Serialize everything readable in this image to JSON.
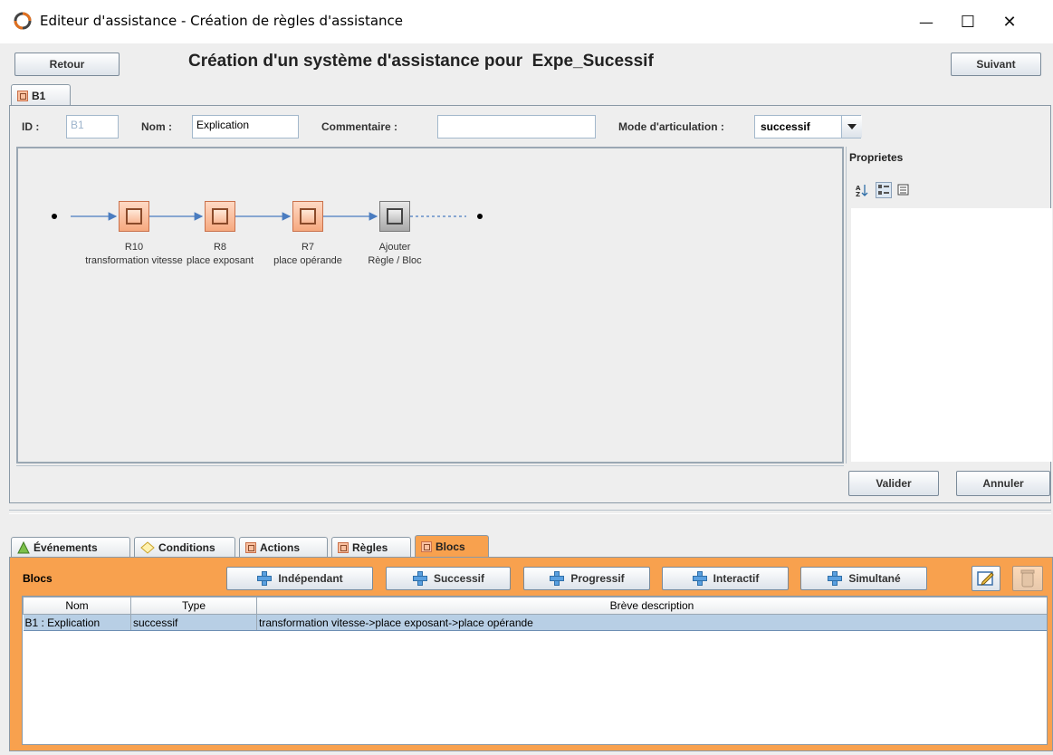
{
  "window": {
    "title": "Editeur d'assistance - Création de règles d'assistance",
    "controls": [
      "—",
      "☐",
      "✕"
    ]
  },
  "header": {
    "back_label": "Retour",
    "title": "Création d'un système d'assistance pour  Expe_Sucessif",
    "next_label": "Suivant"
  },
  "block_tab": {
    "label": "B1"
  },
  "form": {
    "id_label": "ID :",
    "id_value": "B1",
    "name_label": "Nom :",
    "name_value": "Explication",
    "comment_label": "Commentaire :",
    "comment_value": "",
    "mode_label": "Mode d'articulation :",
    "mode_value": "successif"
  },
  "diagram": {
    "nodes": [
      {
        "id": "R10",
        "label": "transformation vitesse"
      },
      {
        "id": "R8",
        "label": "place exposant"
      },
      {
        "id": "R7",
        "label": "place opérande"
      },
      {
        "id": "Ajouter",
        "label": "Règle / Bloc"
      }
    ]
  },
  "properties": {
    "title": "Proprietes",
    "icons": [
      "sort-az-icon",
      "categorized-icon",
      "description-icon"
    ]
  },
  "form_actions": {
    "validate_label": "Valider",
    "cancel_label": "Annuler"
  },
  "bottom_tabs": [
    {
      "label": "Événements",
      "icon": "event-icon"
    },
    {
      "label": "Conditions",
      "icon": "condition-icon"
    },
    {
      "label": "Actions",
      "icon": "block-icon"
    },
    {
      "label": "Règles",
      "icon": "block-icon"
    },
    {
      "label": "Blocs",
      "icon": "block-icon",
      "selected": true
    }
  ],
  "blocs_panel": {
    "title": "Blocs",
    "buttons": [
      "Indépendant",
      "Successif",
      "Progressif",
      "Interactif",
      "Simultané"
    ],
    "columns": [
      "Nom",
      "Type",
      "Brève description"
    ],
    "rows": [
      {
        "nom": "B1 : Explication",
        "type": "successif",
        "description": "transformation vitesse->place exposant->place opérande"
      }
    ]
  },
  "colors": {
    "accent_orange": "#f8a14e",
    "selection": "#b8cfe5",
    "node_fill": "#f6a97f"
  }
}
